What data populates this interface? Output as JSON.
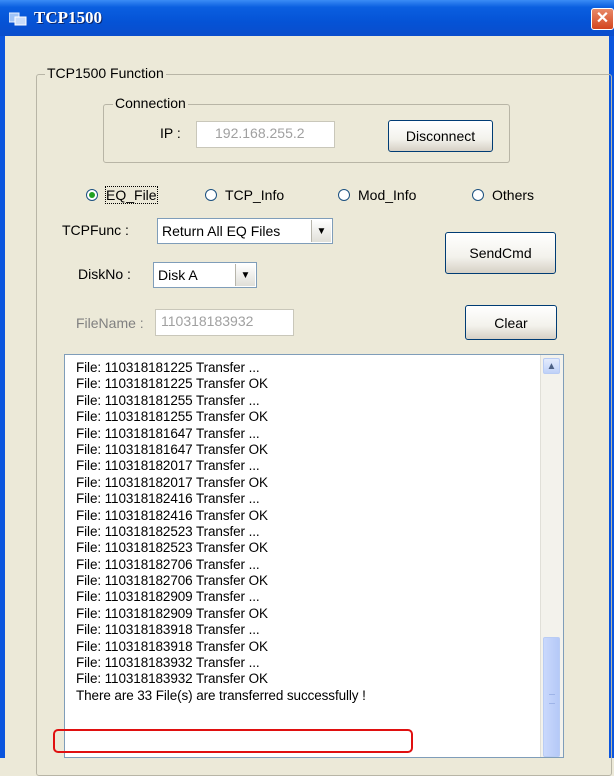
{
  "window": {
    "title": "TCP1500",
    "close_symbol": "✕"
  },
  "function_group": {
    "legend": "TCP1500 Function"
  },
  "connection": {
    "legend": "Connection",
    "ip_label": "IP :",
    "ip_value": "192.168.255.2",
    "disconnect_label": "Disconnect"
  },
  "radios": [
    {
      "label": "EQ_File",
      "selected": true
    },
    {
      "label": "TCP_Info",
      "selected": false
    },
    {
      "label": "Mod_Info",
      "selected": false
    },
    {
      "label": "Others",
      "selected": false
    }
  ],
  "tcpfunc": {
    "label": "TCPFunc :",
    "value": "Return All EQ Files"
  },
  "diskno": {
    "label": "DiskNo :",
    "value": "Disk A"
  },
  "filename": {
    "label": "FileName :",
    "value": "110318183932"
  },
  "buttons": {
    "sendcmd": "SendCmd",
    "clear": "Clear"
  },
  "log": [
    "File: 110318181225 Transfer ...",
    "File: 110318181225 Transfer OK",
    "File: 110318181255 Transfer ...",
    "File: 110318181255 Transfer OK",
    "File: 110318181647 Transfer ...",
    "File: 110318181647 Transfer OK",
    "File: 110318182017 Transfer ...",
    "File: 110318182017 Transfer OK",
    "File: 110318182416 Transfer ...",
    "File: 110318182416 Transfer OK",
    "File: 110318182523 Transfer ...",
    "File: 110318182523 Transfer OK",
    "File: 110318182706 Transfer ...",
    "File: 110318182706 Transfer OK",
    "File: 110318182909 Transfer ...",
    "File: 110318182909 Transfer OK",
    "File: 110318183918 Transfer ...",
    "File: 110318183918 Transfer OK",
    "File: 110318183932 Transfer ...",
    "File: 110318183932 Transfer OK",
    "There are 33 File(s) are transferred successfully !"
  ],
  "colors": {
    "titlebar": "#0553D6",
    "highlight_border": "#E01010",
    "radio_selected": "#21A121"
  },
  "icons": {
    "app": "app-window-icon",
    "close": "close-icon",
    "scroll_up": "scroll-up-arrow-icon",
    "dropdown": "dropdown-arrow-icon"
  }
}
